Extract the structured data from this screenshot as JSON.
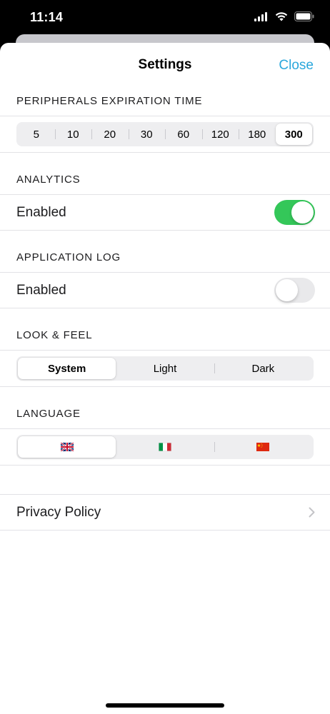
{
  "status_bar": {
    "time": "11:14"
  },
  "nav": {
    "title": "Settings",
    "close_label": "Close"
  },
  "peripherals": {
    "header": "PERIPHERALS EXPIRATION TIME",
    "options": [
      "5",
      "10",
      "20",
      "30",
      "60",
      "120",
      "180",
      "300"
    ],
    "selected": "300"
  },
  "analytics": {
    "header": "ANALYTICS",
    "label": "Enabled",
    "enabled": true
  },
  "app_log": {
    "header": "APPLICATION LOG",
    "label": "Enabled",
    "enabled": false
  },
  "look_feel": {
    "header": "LOOK & FEEL",
    "options": [
      "System",
      "Light",
      "Dark"
    ],
    "selected": "System"
  },
  "language": {
    "header": "LANGUAGE",
    "options": [
      "uk-flag-icon",
      "italy-flag-icon",
      "china-flag-icon"
    ],
    "selected": "uk-flag-icon"
  },
  "privacy": {
    "label": "Privacy Policy"
  },
  "colors": {
    "accent": "#2aa7dc",
    "toggle_on": "#34c759",
    "toggle_off": "#e9e9eb"
  }
}
